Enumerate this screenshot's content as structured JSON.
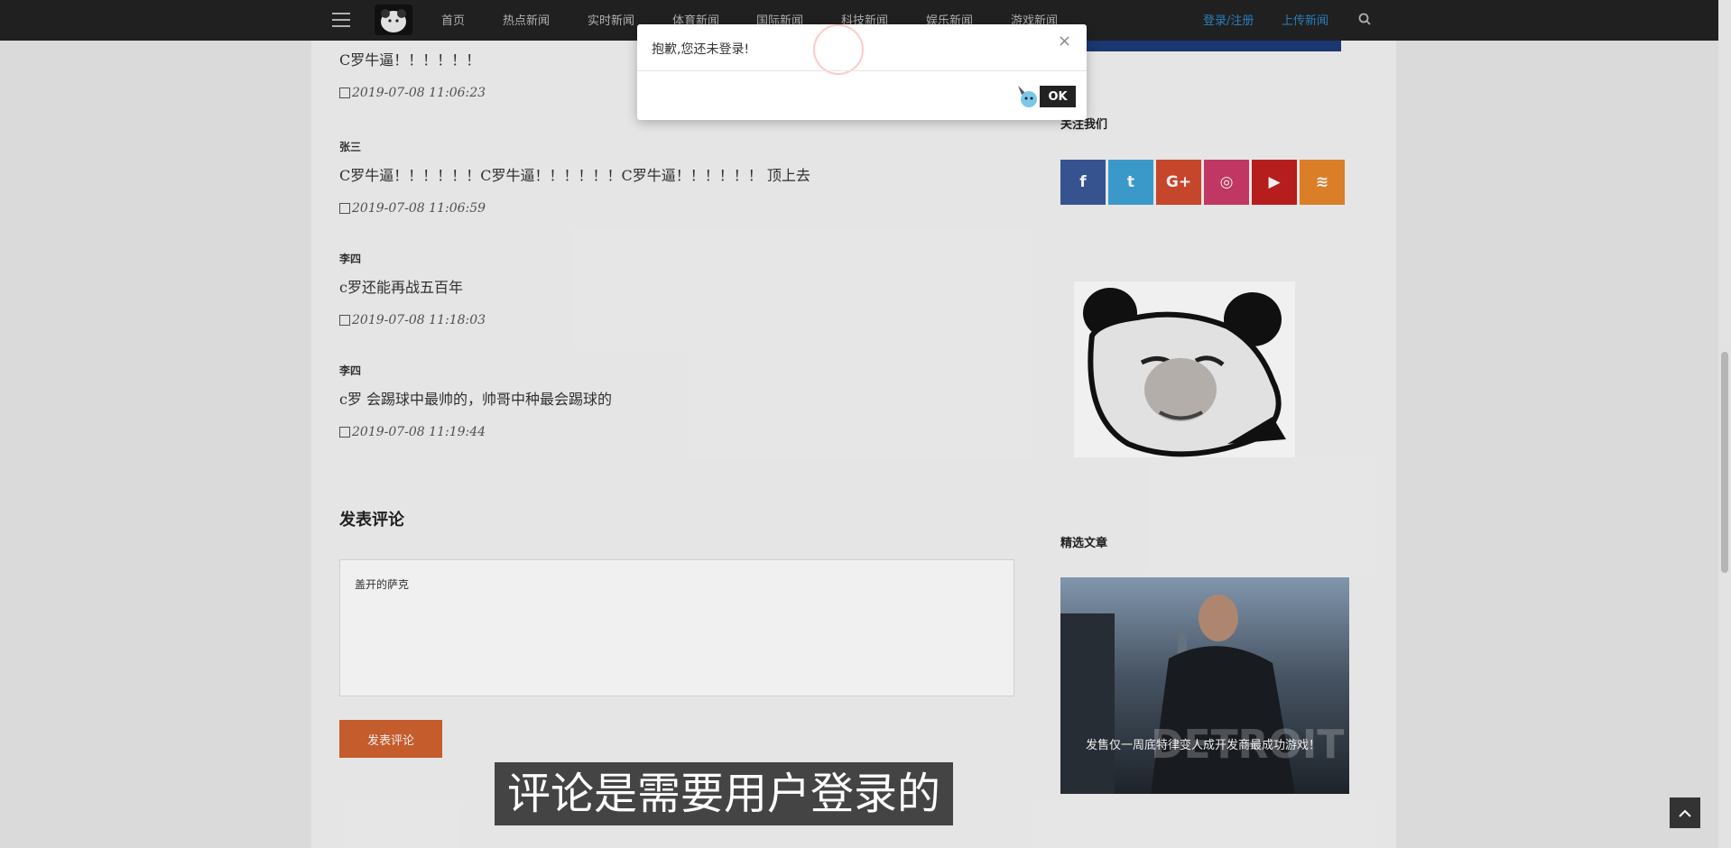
{
  "nav": {
    "items": [
      "首页",
      "热点新闻",
      "实时新闻",
      "体育新闻",
      "国际新闻",
      "科技新闻",
      "娱乐新闻",
      "游戏新闻"
    ],
    "login": "登录/注册",
    "upload": "上传新闻"
  },
  "comments": [
    {
      "author": "",
      "text": "C罗牛逼！！！！！！",
      "time": "2019-07-08 11:06:23"
    },
    {
      "author": "张三",
      "text": "C罗牛逼！！！！！！C罗牛逼！！！！！！C罗牛逼！！！！！！ 顶上去",
      "time": "2019-07-08 11:06:59"
    },
    {
      "author": "李四",
      "text": "c罗还能再战五百年",
      "time": "2019-07-08 11:18:03"
    },
    {
      "author": "李四",
      "text": "c罗 会踢球中最帅的，帅哥中种最会踢球的",
      "time": "2019-07-08 11:19:44"
    }
  ],
  "comment_form": {
    "title": "发表评论",
    "value": "盖开的萨克",
    "submit": "发表评论"
  },
  "sidebar": {
    "follow_title": "关注我们",
    "social": [
      {
        "icon": "facebook-icon",
        "glyph": "f",
        "color": "#3b5998"
      },
      {
        "icon": "twitter-icon",
        "glyph": "t",
        "color": "#3fa3d6"
      },
      {
        "icon": "google-plus-icon",
        "glyph": "G+",
        "color": "#d24b2e"
      },
      {
        "icon": "instagram-icon",
        "glyph": "◎",
        "color": "#cc3b6b"
      },
      {
        "icon": "youtube-icon",
        "glyph": "▶",
        "color": "#c21f1f"
      },
      {
        "icon": "rss-icon",
        "glyph": "≋",
        "color": "#e8862a"
      }
    ],
    "featured_title": "精选文章",
    "featured_caption": "发售仅一周底特律变人成开发商最成功游戏！"
  },
  "dialog": {
    "message": "抱歉,您还未登录!",
    "ok": "OK",
    "close": "×"
  },
  "subtitle": "评论是需要用户登录的"
}
